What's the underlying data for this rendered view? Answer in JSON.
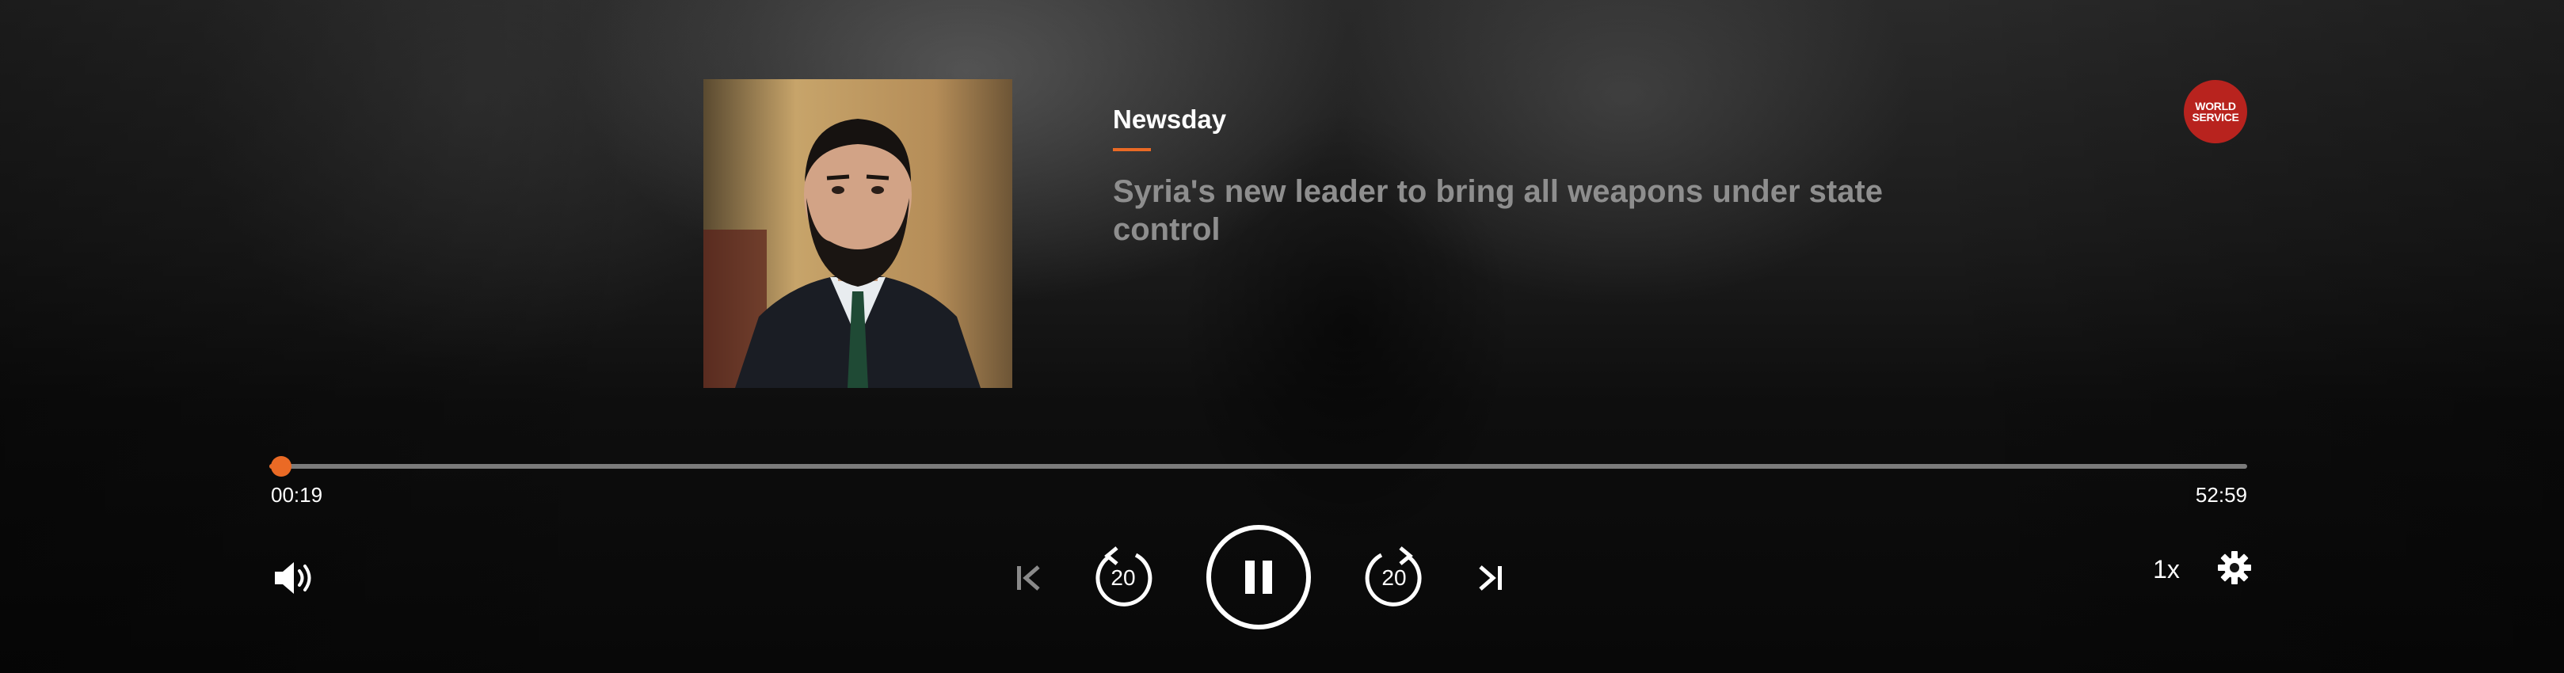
{
  "show": {
    "title": "Newsday"
  },
  "episode": {
    "title": "Syria's new leader to bring all weapons under state control"
  },
  "brand": {
    "line1": "WORLD",
    "line2": "SERVICE"
  },
  "playback": {
    "elapsed": "00:19",
    "duration": "52:59",
    "progress_fraction": 0.006,
    "state": "playing",
    "speed": "1x"
  },
  "controls": {
    "rewind_seconds": "20",
    "forward_seconds": "20"
  },
  "icons": [
    "volume-icon",
    "previous-track-icon",
    "rewind-20-icon",
    "pause-icon",
    "forward-20-icon",
    "next-track-icon",
    "gear-icon"
  ],
  "colors": {
    "accent": "#ea6a25",
    "brand_badge": "#b8231e",
    "episode_title": "#8e8e8e",
    "track": "#7b7b7b"
  }
}
